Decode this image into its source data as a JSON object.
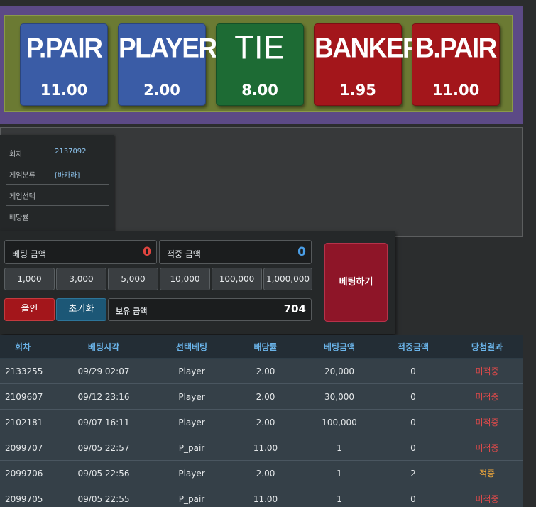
{
  "board": {
    "bets": [
      {
        "name": "P.PAIR",
        "odds": "11.00",
        "color": "#3a5ca6"
      },
      {
        "name": "PLAYER",
        "odds": "2.00",
        "color": "#3a5ca6"
      },
      {
        "name": "TIE",
        "odds": "8.00",
        "color": "#1d6b34"
      },
      {
        "name": "BANKER",
        "odds": "1.95",
        "color": "#a3161b"
      },
      {
        "name": "B.PAIR",
        "odds": "11.00",
        "color": "#a3161b"
      }
    ]
  },
  "info": {
    "round_label": "회차",
    "round_value": "2137092",
    "category_label": "게임분류",
    "category_value": "[바카라]",
    "selection_label": "게임선택",
    "selection_value": "",
    "odds_label": "배당률",
    "odds_value": ""
  },
  "controls": {
    "bet_amount_label": "베팅 금액",
    "bet_amount_value": "0",
    "win_amount_label": "적중 금액",
    "win_amount_value": "0",
    "chips": [
      "1,000",
      "3,000",
      "5,000",
      "10,000",
      "100,000",
      "1,000,000"
    ],
    "allin_label": "올인",
    "reset_label": "초기화",
    "balance_label": "보유 금액",
    "balance_value": "704",
    "bet_button_label": "베팅하기",
    "colors": {
      "bet_amount": "#e0453f",
      "win_amount": "#4a9ee6"
    }
  },
  "history": {
    "columns": [
      "회차",
      "베팅시각",
      "선택베팅",
      "배당률",
      "베팅금액",
      "적중금액",
      "당첨결과"
    ],
    "rows": [
      [
        "2133255",
        "09/29 02:07",
        "Player",
        "2.00",
        "20,000",
        "0",
        "미적중"
      ],
      [
        "2109607",
        "09/12 23:16",
        "Player",
        "2.00",
        "30,000",
        "0",
        "미적중"
      ],
      [
        "2102181",
        "09/07 16:11",
        "Player",
        "2.00",
        "100,000",
        "0",
        "미적중"
      ],
      [
        "2099707",
        "09/05 22:57",
        "P_pair",
        "11.00",
        "1",
        "0",
        "미적중"
      ],
      [
        "2099706",
        "09/05 22:56",
        "Player",
        "2.00",
        "1",
        "2",
        "적중"
      ],
      [
        "2099705",
        "09/05 22:55",
        "P_pair",
        "11.00",
        "1",
        "0",
        "미적중"
      ]
    ]
  }
}
